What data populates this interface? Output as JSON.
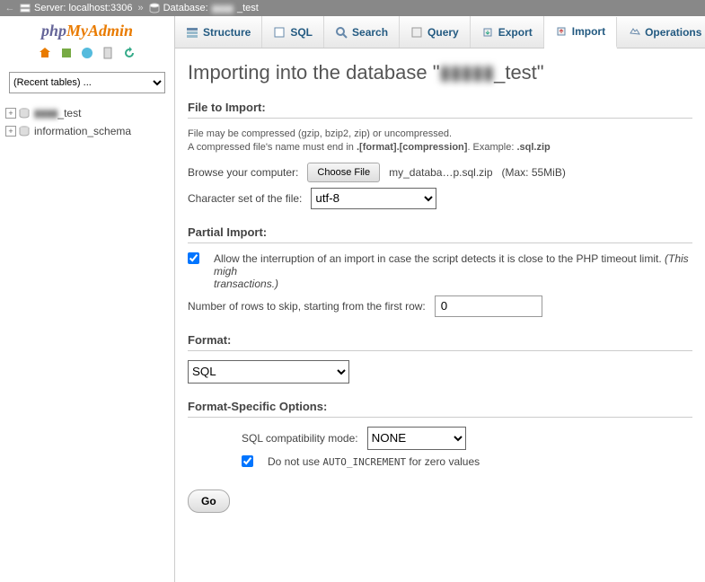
{
  "breadcrumb": {
    "server_label": "Server: localhost:3306",
    "db_label_prefix": "Database:",
    "db_name_blur": "▮▮▮▮",
    "db_name_suffix": "_test"
  },
  "logo": {
    "part1": "php",
    "part2": "MyAdmin"
  },
  "sidebar": {
    "recent_placeholder": "(Recent tables) ...",
    "dbs": [
      {
        "name_blur": "▮▮▮▮",
        "suffix": "_test"
      },
      {
        "name": "information_schema"
      }
    ]
  },
  "tabs": {
    "structure": "Structure",
    "sql": "SQL",
    "search": "Search",
    "query": "Query",
    "export": "Export",
    "import": "Import",
    "operations": "Operations"
  },
  "page": {
    "heading_prefix": "Importing into the database \"",
    "heading_blur": "▮▮▮▮▮",
    "heading_suffix": "_test\"",
    "file_to_import": "File to Import:",
    "note1": "File may be compressed (gzip, bzip2, zip) or uncompressed.",
    "note2a": "A compressed file's name must end in ",
    "note2b": ".[format].[compression]",
    "note2c": ". Example: ",
    "note2d": ".sql.zip",
    "browse_label": "Browse your computer:",
    "choose_file": "Choose File",
    "chosen_file": "my_databa…p.sql.zip",
    "max_size": "(Max: 55MiB)",
    "charset_label": "Character set of the file:",
    "charset_value": "utf-8",
    "partial_title": "Partial Import:",
    "partial_text_a": "Allow the interruption of an import in case the script detects it is close to the PHP timeout limit. ",
    "partial_text_b": "(This migh",
    "partial_text_c": "transactions.)",
    "skip_label": "Number of rows to skip, starting from the first row:",
    "skip_value": "0",
    "format_title": "Format:",
    "format_value": "SQL",
    "fso_title": "Format-Specific Options:",
    "compat_label": "SQL compatibility mode:",
    "compat_value": "NONE",
    "auto_inc_a": "Do not use ",
    "auto_inc_b": "AUTO_INCREMENT",
    "auto_inc_c": " for zero values",
    "go": "Go"
  }
}
